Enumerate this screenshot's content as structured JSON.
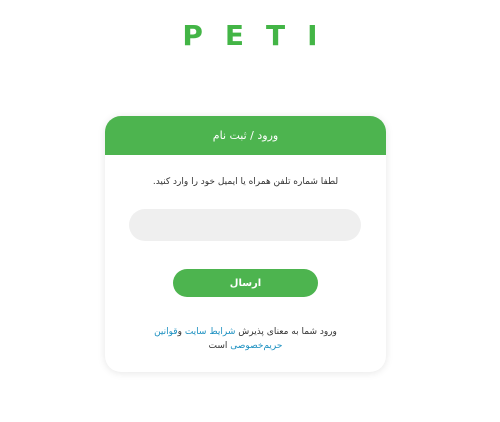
{
  "brand": {
    "logo_text": "PETI",
    "color": "#43b546"
  },
  "card": {
    "header_title": "ورود / ثبت نام",
    "instruction": "لطفا شماره تلفن همراه یا ایمیل خود را وارد کنید.",
    "input_value": "",
    "submit_label": "ارسال",
    "terms": {
      "prefix": "ورود شما به معنای پذیرش ",
      "site_terms_link": "شرایط سایت",
      "middle": " و",
      "privacy_link": "قوانین حریم‌خصوصی",
      "suffix": " است"
    },
    "accent_color": "#4db44f",
    "link_color": "#1a8fc0"
  }
}
